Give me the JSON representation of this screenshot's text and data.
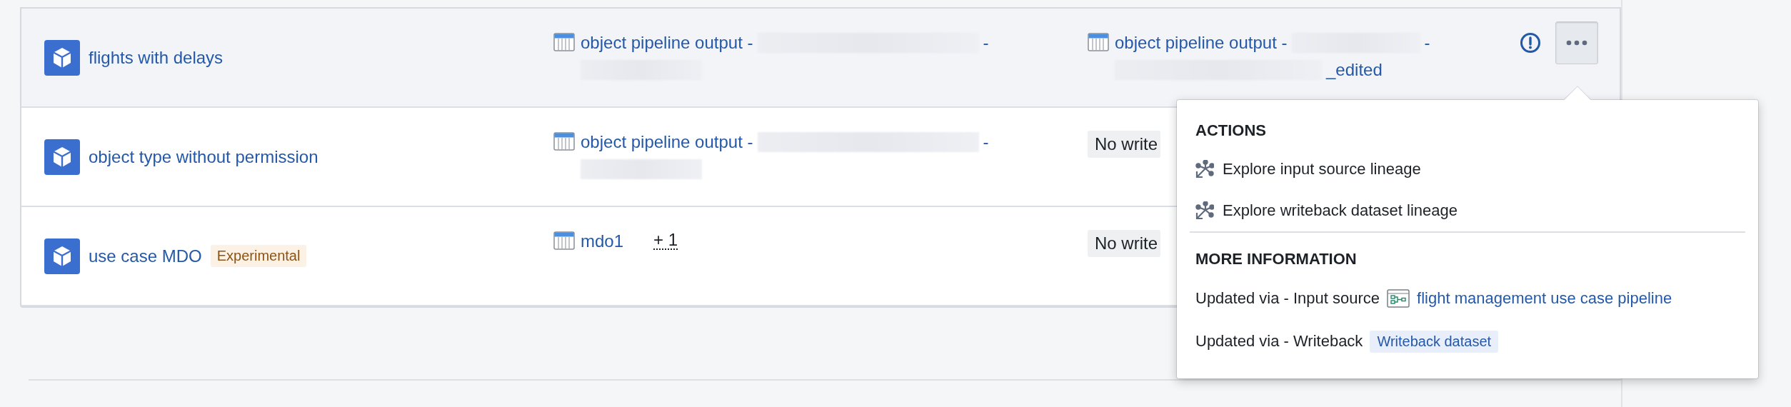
{
  "rows": [
    {
      "name": "flights with delays",
      "highlighted": true,
      "source": {
        "parts": [
          {
            "kind": "text",
            "text": "object pipeline output -"
          },
          {
            "kind": "redacted"
          },
          {
            "kind": "text",
            "text": "-"
          },
          {
            "kind": "redacted"
          }
        ]
      },
      "writeback": {
        "kind": "dataset",
        "parts": [
          {
            "kind": "text",
            "text": "object pipeline output -"
          },
          {
            "kind": "redacted"
          },
          {
            "kind": "text",
            "text": "-"
          },
          {
            "kind": "redacted"
          },
          {
            "kind": "text",
            "text": "_edited"
          }
        ]
      },
      "actions": {
        "warning": true,
        "menu_open": true
      }
    },
    {
      "name": "object type without permission",
      "highlighted": false,
      "source": {
        "parts": [
          {
            "kind": "text",
            "text": "object pipeline output -"
          },
          {
            "kind": "redacted"
          },
          {
            "kind": "text",
            "text": "-"
          },
          {
            "kind": "redacted"
          }
        ]
      },
      "writeback": {
        "kind": "tag",
        "text": "No write"
      }
    },
    {
      "name": "use case MDO",
      "badge": "Experimental",
      "highlighted": false,
      "source": {
        "parts": [
          {
            "kind": "text",
            "text": "mdo1"
          }
        ],
        "more": "+ 1"
      },
      "writeback": {
        "kind": "tag",
        "text": "No write"
      }
    }
  ],
  "menu": {
    "sections": [
      {
        "title": "ACTIONS",
        "items": [
          {
            "kind": "action",
            "label": "Explore input source lineage"
          },
          {
            "kind": "action",
            "label": "Explore writeback dataset lineage"
          }
        ]
      },
      {
        "title": "MORE INFORMATION",
        "items": [
          {
            "kind": "pipeline",
            "label": "Updated via - Input source",
            "link": "flight management use case pipeline"
          },
          {
            "kind": "tag",
            "label": "Updated via - Writeback",
            "tag": "Writeback dataset"
          }
        ]
      }
    ]
  }
}
